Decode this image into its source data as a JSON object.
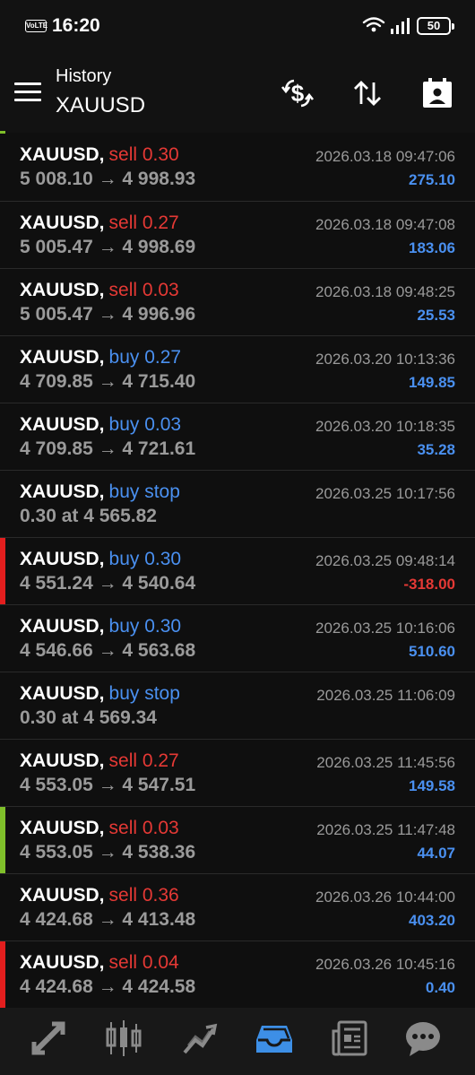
{
  "status_bar": {
    "volte": "VoLTE",
    "time": "16:20",
    "battery": "50"
  },
  "header": {
    "title": "History",
    "symbol": "XAUUSD",
    "icons": [
      "currency-exchange-icon",
      "sort-icon",
      "calendar-icon"
    ]
  },
  "colors": {
    "sell": "#e53935",
    "buy": "#4a90f0",
    "profit_positive": "#4a90f0",
    "profit_negative": "#e53935",
    "edge_red": "#e31e1e",
    "edge_green": "#7fbf2a"
  },
  "trades": [
    {
      "symbol": "XAUUSD,",
      "side": "sell 0.30",
      "type": "sell",
      "prices": "5 008.10 → 4 998.93",
      "time": "2026.03.18 09:47:06",
      "profit": "275.10",
      "edge": ""
    },
    {
      "symbol": "XAUUSD,",
      "side": "sell 0.27",
      "type": "sell",
      "prices": "5 005.47 → 4 998.69",
      "time": "2026.03.18 09:47:08",
      "profit": "183.06",
      "edge": ""
    },
    {
      "symbol": "XAUUSD,",
      "side": "sell 0.03",
      "type": "sell",
      "prices": "5 005.47 → 4 996.96",
      "time": "2026.03.18 09:48:25",
      "profit": "25.53",
      "edge": ""
    },
    {
      "symbol": "XAUUSD,",
      "side": "buy 0.27",
      "type": "buy",
      "prices": "4 709.85 → 4 715.40",
      "time": "2026.03.20 10:13:36",
      "profit": "149.85",
      "edge": ""
    },
    {
      "symbol": "XAUUSD,",
      "side": "buy 0.03",
      "type": "buy",
      "prices": "4 709.85 → 4 721.61",
      "time": "2026.03.20 10:18:35",
      "profit": "35.28",
      "edge": ""
    },
    {
      "symbol": "XAUUSD,",
      "side": "buy stop",
      "type": "buy",
      "prices": "0.30 at 4 565.82",
      "time": "2026.03.25 10:17:56",
      "profit": "",
      "edge": ""
    },
    {
      "symbol": "XAUUSD,",
      "side": "buy 0.30",
      "type": "buy",
      "prices": "4 551.24 → 4 540.64",
      "time": "2026.03.25 09:48:14",
      "profit": "-318.00",
      "edge": "red"
    },
    {
      "symbol": "XAUUSD,",
      "side": "buy 0.30",
      "type": "buy",
      "prices": "4 546.66 → 4 563.68",
      "time": "2026.03.25 10:16:06",
      "profit": "510.60",
      "edge": ""
    },
    {
      "symbol": "XAUUSD,",
      "side": "buy stop",
      "type": "buy",
      "prices": "0.30 at 4 569.34",
      "time": "2026.03.25 11:06:09",
      "profit": "",
      "edge": ""
    },
    {
      "symbol": "XAUUSD,",
      "side": "sell 0.27",
      "type": "sell",
      "prices": "4 553.05 → 4 547.51",
      "time": "2026.03.25 11:45:56",
      "profit": "149.58",
      "edge": ""
    },
    {
      "symbol": "XAUUSD,",
      "side": "sell 0.03",
      "type": "sell",
      "prices": "4 553.05 → 4 538.36",
      "time": "2026.03.25 11:47:48",
      "profit": "44.07",
      "edge": "green"
    },
    {
      "symbol": "XAUUSD,",
      "side": "sell 0.36",
      "type": "sell",
      "prices": "4 424.68 → 4 413.48",
      "time": "2026.03.26 10:44:00",
      "profit": "403.20",
      "edge": ""
    },
    {
      "symbol": "XAUUSD,",
      "side": "sell 0.04",
      "type": "sell",
      "prices": "4 424.68 → 4 424.58",
      "time": "2026.03.26 10:45:16",
      "profit": "0.40",
      "edge": "red"
    }
  ],
  "bottom_nav": {
    "items": [
      "quotes-icon",
      "chart-icon",
      "trade-icon",
      "history-icon",
      "news-icon",
      "messages-icon"
    ],
    "active": "history-icon"
  }
}
